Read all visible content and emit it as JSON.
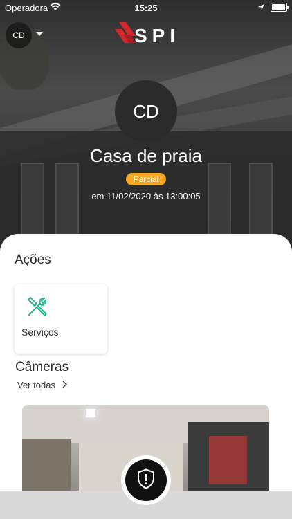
{
  "status_bar": {
    "carrier": "Operadora",
    "time": "15:25"
  },
  "header": {
    "account_initials": "CD",
    "logo_text": "SPI",
    "property_initials": "CD",
    "property_name": "Casa de praia",
    "status_badge": "Parcial",
    "last_update": "em 11/02/2020 às 13:00:05"
  },
  "actions": {
    "title": "Ações",
    "items": [
      {
        "label": "Serviços",
        "icon": "tools-icon"
      }
    ]
  },
  "cameras": {
    "title": "Câmeras",
    "see_all": "Ver todas"
  },
  "colors": {
    "accent_orange": "#f5a623",
    "tool_green": "#2bb38a",
    "logo_red": "#d9262c"
  }
}
